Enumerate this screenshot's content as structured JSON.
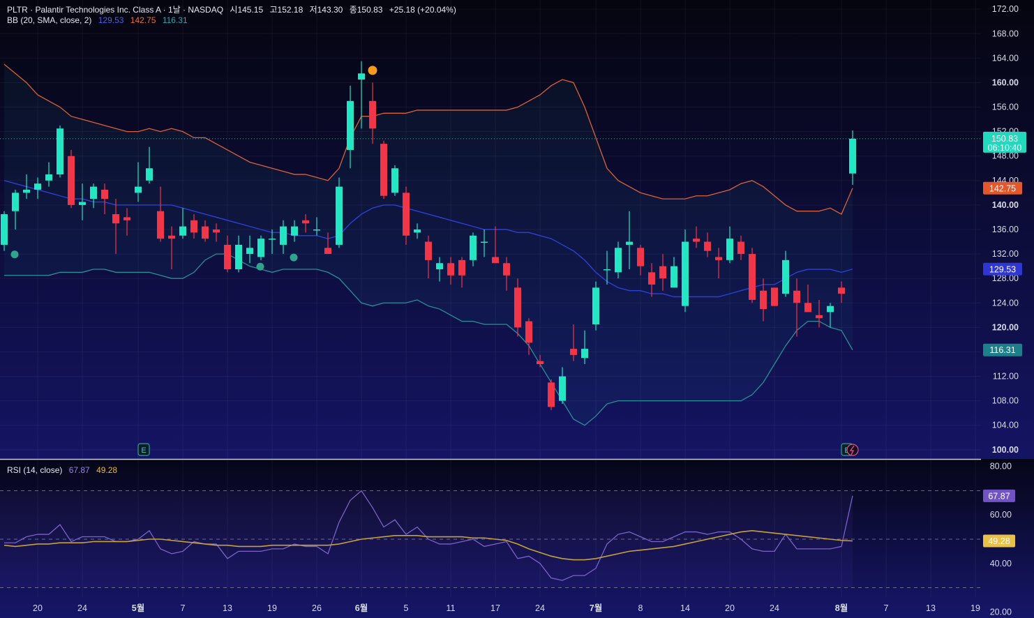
{
  "header": {
    "symbol": "PLTR · Palantir Technologies Inc. Class A · 1날 · NASDAQ",
    "open": "시145.15",
    "high": "고152.18",
    "low": "저143.30",
    "close": "종150.83",
    "change": "+25.18 (+20.04%)",
    "bb_label": "BB (20, SMA, close, 2)",
    "bb_mid": "129.53",
    "bb_upper": "142.75",
    "bb_lower": "116.31",
    "rsi_label": "RSI (14, close)",
    "rsi_value": "67.87",
    "rsi_ma": "49.28"
  },
  "colors": {
    "up": "#22e6c4",
    "down": "#f2364a",
    "bb_upper": "#d9623a",
    "bb_mid": "#2f3fd6",
    "bb_lower": "#2a8f96",
    "rsi": "#7b62c8",
    "rsi_ma": "#c7a23a"
  },
  "price_tags": {
    "last_price": "150.83",
    "countdown": "06:10:40",
    "upper": "142.75",
    "mid": "129.53",
    "lower": "116.31"
  },
  "rsi_tags": {
    "rsi": "67.87",
    "ma": "49.28"
  },
  "event_markers": [
    "E",
    "E"
  ],
  "chart_data": {
    "type": "candlestick",
    "title": "PLTR · Palantir Technologies Inc. Class A · 1날 · NASDAQ",
    "price_axis": {
      "ylim": [
        98.5,
        173.5
      ],
      "ticks": [
        "172.00",
        "168.00",
        "164.00",
        "160.00",
        "156.00",
        "152.00",
        "148.00",
        "144.00",
        "140.00",
        "136.00",
        "132.00",
        "128.00",
        "124.00",
        "120.00",
        "116.00",
        "112.00",
        "108.00",
        "104.00",
        "100.00"
      ]
    },
    "rsi_axis": {
      "ylim": [
        17.5,
        82.5
      ],
      "ticks": [
        "80.00",
        "60.00",
        "40.00",
        "20.00"
      ],
      "bands": [
        70,
        50,
        30
      ]
    },
    "x_ticks": [
      {
        "i": 3,
        "label": "20"
      },
      {
        "i": 7,
        "label": "24"
      },
      {
        "i": 12,
        "label": "5월"
      },
      {
        "i": 16,
        "label": "7"
      },
      {
        "i": 20,
        "label": "13"
      },
      {
        "i": 24,
        "label": "19"
      },
      {
        "i": 28,
        "label": "26"
      },
      {
        "i": 32,
        "label": "6월"
      },
      {
        "i": 36,
        "label": "5"
      },
      {
        "i": 40,
        "label": "11"
      },
      {
        "i": 44,
        "label": "17"
      },
      {
        "i": 48,
        "label": "24"
      },
      {
        "i": 53,
        "label": "7월"
      },
      {
        "i": 57,
        "label": "8"
      },
      {
        "i": 61,
        "label": "14"
      },
      {
        "i": 65,
        "label": "20"
      },
      {
        "i": 69,
        "label": "24"
      },
      {
        "i": 75,
        "label": "8월"
      },
      {
        "i": 79,
        "label": "7"
      },
      {
        "i": 83,
        "label": "13"
      },
      {
        "i": 87,
        "label": "19"
      }
    ],
    "candles": [
      [
        133.5,
        139.0,
        132.5,
        138.5
      ],
      [
        139.0,
        142.5,
        136.0,
        142.0
      ],
      [
        142.0,
        145.0,
        141.0,
        142.5
      ],
      [
        142.5,
        144.5,
        141.0,
        143.5
      ],
      [
        144.0,
        147.0,
        143.0,
        145.0
      ],
      [
        145.0,
        153.0,
        144.5,
        152.5
      ],
      [
        148.0,
        149.0,
        139.5,
        140.0
      ],
      [
        140.0,
        143.5,
        137.5,
        140.5
      ],
      [
        141.0,
        143.5,
        139.5,
        143.0
      ],
      [
        142.5,
        143.5,
        138.5,
        141.0
      ],
      [
        138.5,
        141.0,
        132.0,
        137.0
      ],
      [
        138.0,
        139.5,
        135.0,
        137.5
      ],
      [
        142.0,
        147.0,
        140.5,
        143.0
      ],
      [
        144.0,
        149.5,
        143.5,
        146.0
      ],
      [
        139.0,
        143.0,
        134.0,
        134.5
      ],
      [
        135.0,
        136.5,
        129.5,
        134.5
      ],
      [
        135.0,
        139.5,
        134.5,
        136.5
      ],
      [
        137.5,
        138.5,
        134.5,
        135.5
      ],
      [
        136.5,
        137.5,
        134.0,
        134.5
      ],
      [
        136.0,
        137.0,
        134.0,
        135.5
      ],
      [
        133.5,
        135.0,
        129.0,
        129.5
      ],
      [
        129.5,
        135.0,
        129.0,
        133.5
      ],
      [
        132.0,
        135.0,
        130.5,
        133.0
      ],
      [
        131.5,
        135.0,
        131.0,
        134.5
      ],
      [
        134.5,
        136.0,
        132.0,
        134.5
      ],
      [
        133.5,
        137.5,
        132.0,
        136.5
      ],
      [
        135.0,
        137.5,
        134.0,
        136.5
      ],
      [
        137.5,
        138.5,
        135.5,
        137.0
      ],
      [
        136.0,
        138.0,
        135.0,
        136.0
      ],
      [
        133.0,
        135.5,
        132.0,
        132.0
      ],
      [
        133.5,
        144.5,
        133.0,
        143.0
      ],
      [
        149.0,
        159.5,
        146.0,
        157.0
      ],
      [
        160.5,
        163.5,
        152.5,
        161.5
      ],
      [
        157.0,
        160.0,
        150.0,
        152.5
      ],
      [
        150.0,
        150.5,
        141.0,
        141.5
      ],
      [
        142.0,
        146.5,
        141.5,
        146.0
      ],
      [
        142.0,
        143.0,
        133.5,
        135.0
      ],
      [
        135.5,
        137.0,
        134.5,
        136.0
      ],
      [
        134.0,
        135.0,
        128.0,
        131.0
      ],
      [
        129.5,
        131.5,
        127.5,
        130.5
      ],
      [
        130.5,
        131.5,
        127.0,
        128.5
      ],
      [
        131.0,
        131.5,
        126.5,
        128.5
      ],
      [
        131.0,
        135.5,
        130.0,
        135.0
      ],
      [
        134.0,
        136.0,
        131.5,
        134.0
      ],
      [
        131.5,
        136.5,
        130.5,
        130.5
      ],
      [
        130.5,
        131.5,
        126.0,
        128.5
      ],
      [
        126.5,
        128.0,
        118.5,
        120.0
      ],
      [
        121.0,
        121.5,
        115.5,
        117.5
      ],
      [
        114.5,
        115.5,
        113.5,
        114.0
      ],
      [
        111.0,
        111.5,
        106.5,
        107.0
      ],
      [
        108.0,
        113.5,
        107.5,
        112.0
      ],
      [
        116.5,
        120.5,
        114.5,
        115.5
      ],
      [
        115.0,
        119.5,
        114.0,
        116.5
      ],
      [
        120.5,
        127.5,
        119.5,
        126.5
      ],
      [
        129.5,
        132.5,
        127.0,
        129.5
      ],
      [
        129.0,
        134.0,
        128.0,
        133.0
      ],
      [
        133.5,
        139.0,
        129.5,
        134.0
      ],
      [
        133.0,
        133.5,
        128.5,
        130.0
      ],
      [
        129.0,
        130.5,
        125.0,
        127.0
      ],
      [
        130.0,
        132.0,
        126.0,
        128.0
      ],
      [
        126.5,
        131.5,
        126.5,
        130.0
      ],
      [
        123.5,
        136.0,
        122.5,
        134.0
      ],
      [
        134.5,
        136.5,
        133.0,
        134.0
      ],
      [
        134.0,
        135.5,
        131.5,
        132.5
      ],
      [
        131.5,
        133.0,
        128.0,
        131.0
      ],
      [
        131.0,
        136.5,
        130.5,
        134.5
      ],
      [
        134.0,
        135.0,
        131.0,
        132.0
      ],
      [
        132.0,
        133.0,
        124.0,
        124.5
      ],
      [
        126.0,
        128.0,
        121.0,
        123.0
      ],
      [
        126.5,
        126.5,
        123.5,
        123.5
      ],
      [
        125.5,
        132.5,
        125.0,
        131.0
      ],
      [
        126.0,
        128.0,
        118.5,
        124.0
      ],
      [
        124.0,
        127.0,
        122.5,
        122.5
      ],
      [
        122.0,
        124.5,
        120.0,
        121.5
      ],
      [
        122.5,
        124.0,
        120.0,
        123.5
      ],
      [
        126.5,
        127.5,
        124.0,
        125.5
      ],
      [
        145.15,
        152.18,
        143.3,
        150.83
      ]
    ],
    "series": [
      {
        "name": "upper",
        "values": [
          163.0,
          161.5,
          160.0,
          158.0,
          157.0,
          156.0,
          154.5,
          154.0,
          153.5,
          153.0,
          152.5,
          152.0,
          152.0,
          152.5,
          152.0,
          152.5,
          152.0,
          151.0,
          151.0,
          150.0,
          149.0,
          148.0,
          147.0,
          146.5,
          146.0,
          145.5,
          145.0,
          145.0,
          144.5,
          144.0,
          146.0,
          151.0,
          154.5,
          154.5,
          155.0,
          155.0,
          155.0,
          155.5,
          155.5,
          155.5,
          155.5,
          155.5,
          155.5,
          155.5,
          155.5,
          155.5,
          156.0,
          157.0,
          158.0,
          159.5,
          160.5,
          160.0,
          156.0,
          151.0,
          146.0,
          144.0,
          143.0,
          142.0,
          141.5,
          141.0,
          141.0,
          141.0,
          141.5,
          141.5,
          142.0,
          142.5,
          143.5,
          144.0,
          143.0,
          141.5,
          140.0,
          139.0,
          139.0,
          139.0,
          139.5,
          138.5,
          142.75
        ]
      },
      {
        "name": "mid",
        "values": [
          144.0,
          143.5,
          143.0,
          142.5,
          142.0,
          141.5,
          141.0,
          141.0,
          140.5,
          140.5,
          140.0,
          140.0,
          140.0,
          140.0,
          140.0,
          140.0,
          139.5,
          139.0,
          138.5,
          138.0,
          137.5,
          137.0,
          136.5,
          136.0,
          135.5,
          135.5,
          135.0,
          135.0,
          135.0,
          134.5,
          135.0,
          137.0,
          138.5,
          139.5,
          140.0,
          140.0,
          139.5,
          139.0,
          138.5,
          138.0,
          137.5,
          137.0,
          136.5,
          136.0,
          136.0,
          136.0,
          135.5,
          135.5,
          135.0,
          134.5,
          133.5,
          132.5,
          131.0,
          129.0,
          127.5,
          126.5,
          126.0,
          126.0,
          125.5,
          125.5,
          125.0,
          125.0,
          125.0,
          125.0,
          125.0,
          125.5,
          126.0,
          126.5,
          127.0,
          127.0,
          128.0,
          129.0,
          129.5,
          129.5,
          129.5,
          129.0,
          129.53
        ]
      },
      {
        "name": "lower",
        "values": [
          128.5,
          128.5,
          128.5,
          128.5,
          128.5,
          129.0,
          129.0,
          129.0,
          129.5,
          129.5,
          129.0,
          129.0,
          129.0,
          129.0,
          128.5,
          128.0,
          128.0,
          129.0,
          131.0,
          132.0,
          132.0,
          131.0,
          130.0,
          129.5,
          129.0,
          129.5,
          129.5,
          129.5,
          129.5,
          129.0,
          128.0,
          126.0,
          124.0,
          123.5,
          124.0,
          124.0,
          124.0,
          124.5,
          123.5,
          123.0,
          122.0,
          121.0,
          121.0,
          120.5,
          120.5,
          120.5,
          119.0,
          117.0,
          114.0,
          111.0,
          108.0,
          105.0,
          104.0,
          105.5,
          107.5,
          108.0,
          108.0,
          108.0,
          108.0,
          108.0,
          108.0,
          108.0,
          108.0,
          108.0,
          108.0,
          108.0,
          108.0,
          109.0,
          111.0,
          114.0,
          117.0,
          119.5,
          121.0,
          121.0,
          120.0,
          119.5,
          116.31
        ]
      },
      {
        "name": "rsi",
        "values": [
          48.5,
          48.5,
          51,
          52,
          52,
          56,
          49,
          51,
          51,
          51,
          49,
          49,
          50,
          53.5,
          46,
          44,
          45,
          49,
          48,
          48,
          42,
          45,
          45,
          45,
          46,
          46,
          48,
          47,
          47,
          44,
          57,
          66,
          70,
          63,
          55,
          58,
          52,
          55,
          50,
          48,
          48,
          49,
          50,
          47,
          48,
          49,
          42,
          43,
          40,
          34,
          33,
          35,
          35,
          38,
          48,
          52,
          53,
          51,
          49,
          49,
          51,
          53,
          53,
          52,
          53,
          53,
          50,
          46,
          45,
          45,
          52,
          46,
          46,
          46,
          46,
          47,
          67.87
        ]
      },
      {
        "name": "rsi_ma",
        "values": [
          47.5,
          47,
          47.5,
          48,
          48,
          48.5,
          48.5,
          48.5,
          49,
          49,
          49,
          49,
          49.5,
          50,
          50,
          49.5,
          49,
          48.5,
          48,
          47.5,
          47.5,
          47,
          47,
          47,
          47.5,
          47.5,
          47.5,
          47.5,
          47.5,
          47.5,
          48,
          49,
          50,
          50.5,
          51,
          51.5,
          51.5,
          51.5,
          51,
          51,
          51,
          51,
          50.5,
          50.5,
          50,
          49.5,
          48,
          46,
          44.5,
          43,
          42,
          41.5,
          41.5,
          42,
          43,
          44,
          45,
          45.5,
          46,
          46.5,
          47,
          48,
          49,
          50,
          51,
          52,
          53,
          53.5,
          53,
          52.5,
          52,
          51.5,
          51,
          50.5,
          50,
          49.5,
          49.28
        ]
      }
    ]
  }
}
